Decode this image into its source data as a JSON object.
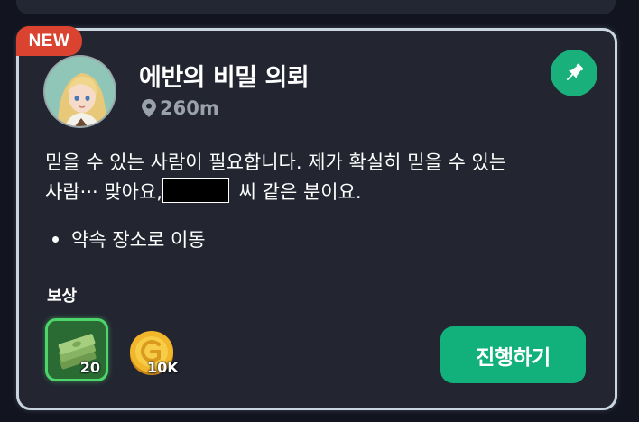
{
  "badge": {
    "label": "NEW"
  },
  "quest": {
    "title": "에반의 비밀 의뢰",
    "distance": "260m",
    "description_line1": "믿을 수 있는 사람이 필요합니다. 제가 확실히 믿을 수 있는",
    "description_line2_prefix": "사람··· 맞아요,",
    "description_line2_suffix": " 씨 같은 분이요.",
    "objective": "약속 장소로 이동"
  },
  "rewards": {
    "label": "보상",
    "items": [
      {
        "icon": "cash-stack-icon",
        "quantity": "20"
      },
      {
        "icon": "gold-coin-icon",
        "quantity": "10K"
      }
    ]
  },
  "actions": {
    "proceed_label": "진행하기"
  },
  "colors": {
    "accent_green": "#12b07a",
    "badge_red": "#d9432f",
    "card_bg": "#232631"
  }
}
